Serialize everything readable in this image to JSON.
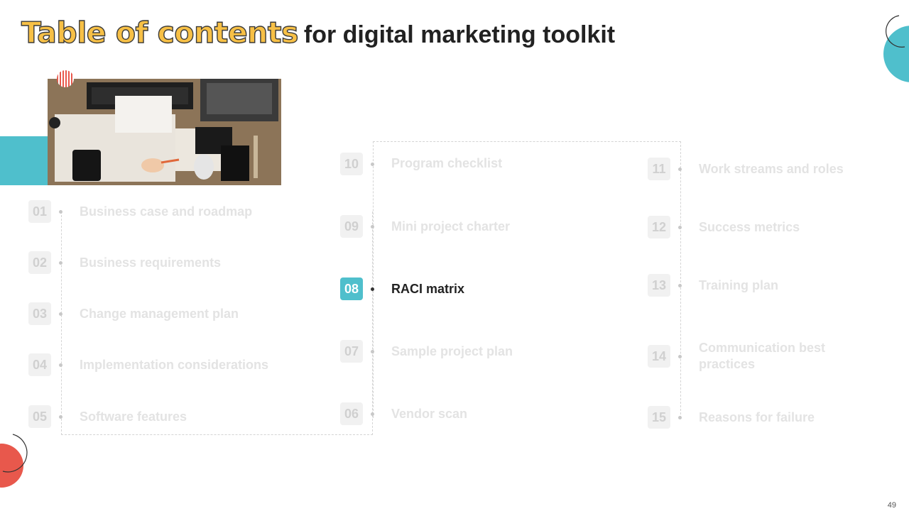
{
  "title": {
    "main": "Table of contents",
    "sub": "for digital marketing toolkit"
  },
  "colors": {
    "accent": "#4FBFCC",
    "title_fill": "#F7C046",
    "coral": "#E8584C"
  },
  "items": [
    {
      "num": "01",
      "label": "Business case and roadmap"
    },
    {
      "num": "02",
      "label": "Business requirements"
    },
    {
      "num": "03",
      "label": "Change management plan"
    },
    {
      "num": "04",
      "label": "Implementation considerations"
    },
    {
      "num": "05",
      "label": "Software features"
    },
    {
      "num": "06",
      "label": "Vendor scan"
    },
    {
      "num": "07",
      "label": "Sample project plan"
    },
    {
      "num": "08",
      "label": "RACI matrix",
      "active": true
    },
    {
      "num": "09",
      "label": "Mini project charter"
    },
    {
      "num": "10",
      "label": "Program checklist"
    },
    {
      "num": "11",
      "label": "Work streams and roles"
    },
    {
      "num": "12",
      "label": "Success metrics"
    },
    {
      "num": "13",
      "label": "Training plan"
    },
    {
      "num": "14",
      "label": "Communication best practices"
    },
    {
      "num": "15",
      "label": "Reasons for failure"
    }
  ],
  "page_number": "49"
}
